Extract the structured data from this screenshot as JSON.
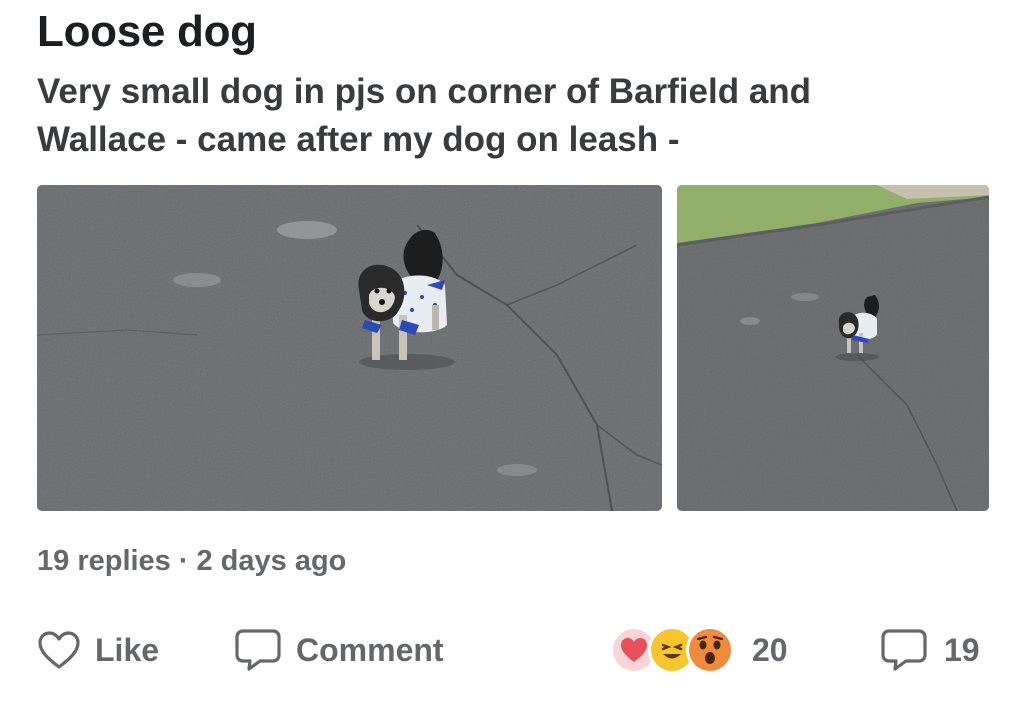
{
  "post": {
    "title": "Loose dog",
    "body": "Very small dog in pjs on corner of Barfield and Wallace - came after my dog on leash -"
  },
  "meta": {
    "replies": "19 replies",
    "separator": "·",
    "time": "2 days ago"
  },
  "actions": {
    "like_label": "Like",
    "comment_label": "Comment",
    "reaction_count": "20",
    "comment_count": "19"
  },
  "reactions": [
    "heart",
    "laughing",
    "surprised"
  ],
  "colors": {
    "title": "#1c1e21",
    "text": "#3a3b3d",
    "muted": "#65676b",
    "heart": "#e8505b",
    "emoji": "#f7b125"
  }
}
